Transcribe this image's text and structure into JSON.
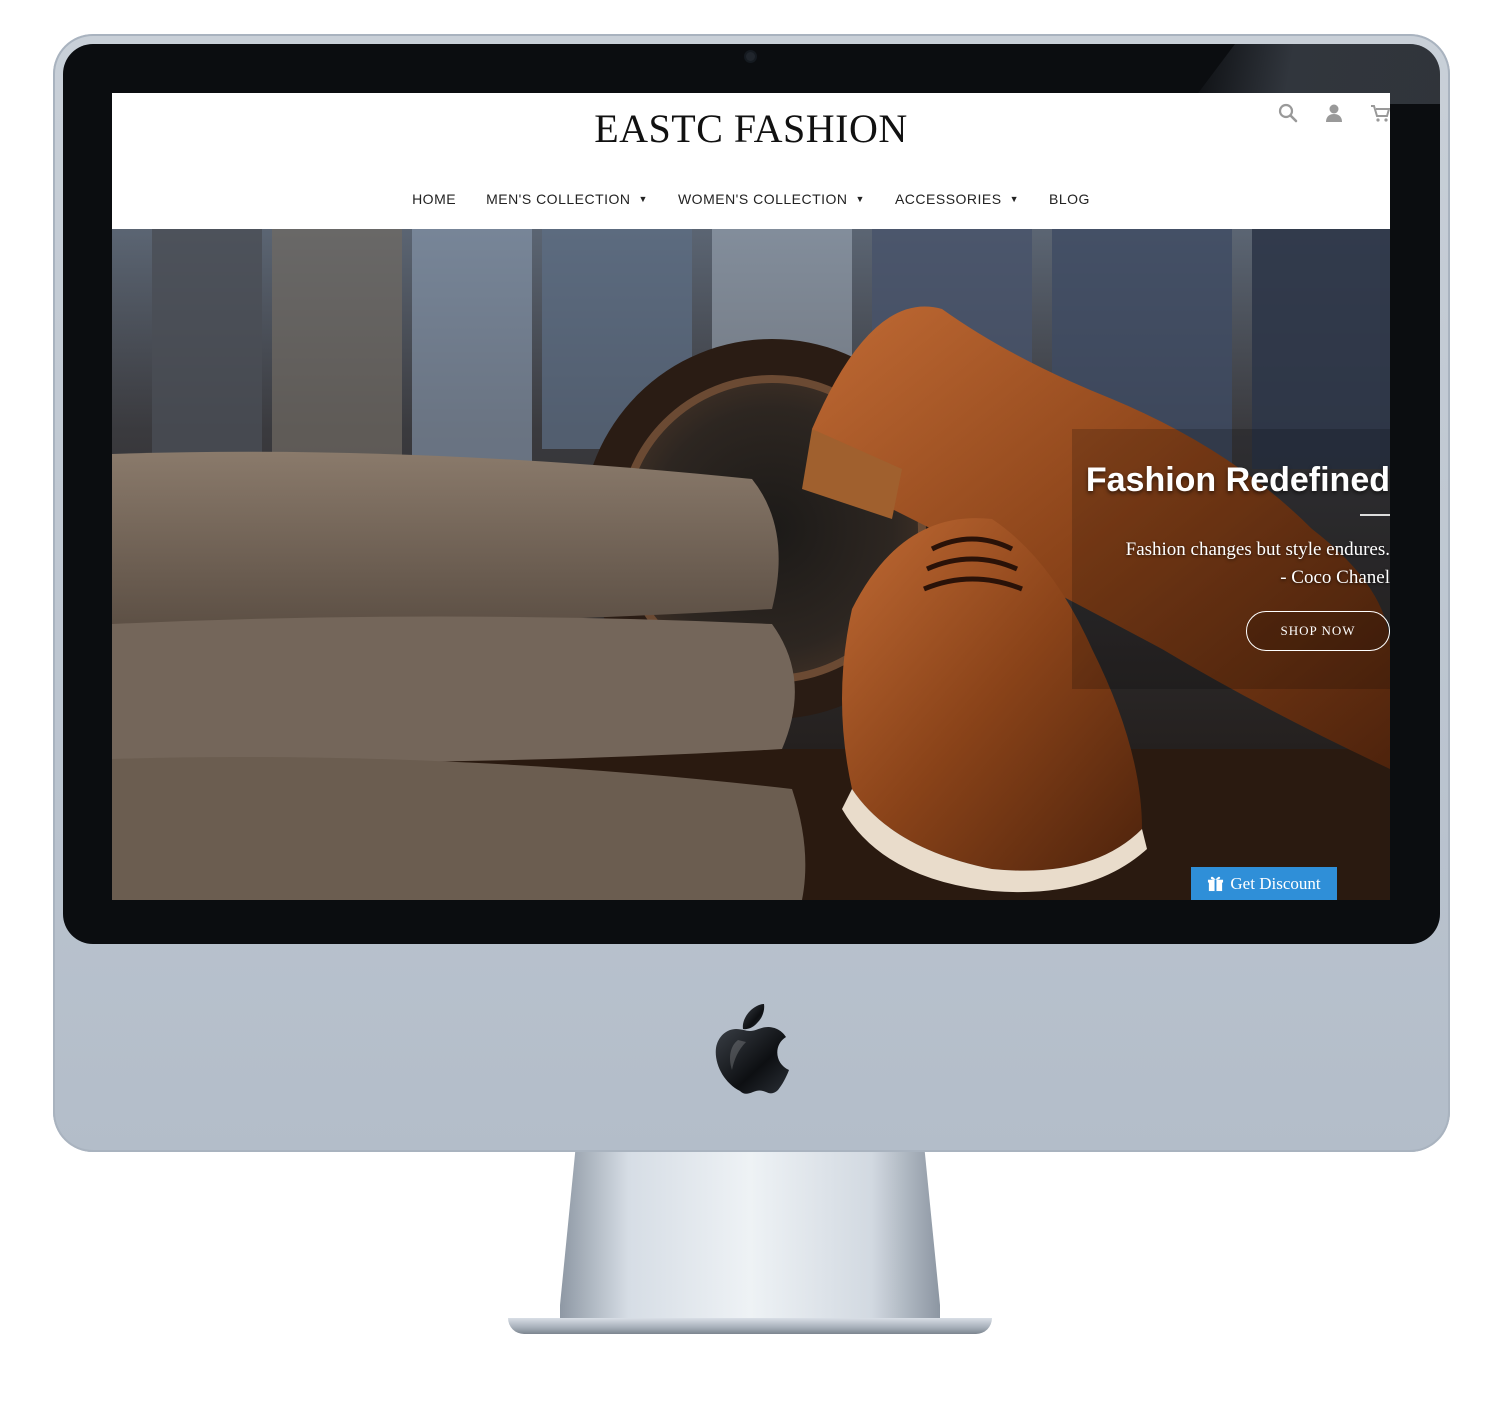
{
  "site": {
    "logo": "EASTC FASHION",
    "nav": [
      {
        "label": "HOME",
        "dropdown": false
      },
      {
        "label": "MEN'S COLLECTION",
        "dropdown": true
      },
      {
        "label": "WOMEN'S COLLECTION",
        "dropdown": true
      },
      {
        "label": "ACCESSORIES",
        "dropdown": true
      },
      {
        "label": "BLOG",
        "dropdown": false
      }
    ],
    "icons": [
      "search-icon",
      "user-icon",
      "cart-icon"
    ]
  },
  "hero": {
    "title": "Fashion Redefined",
    "quote_line1": "Fashion changes but style endures.",
    "quote_line2": "- Coco Chanel",
    "button_label": "SHOP NOW"
  },
  "discount": {
    "label": "Get Discount",
    "color": "#2f8fd8"
  }
}
